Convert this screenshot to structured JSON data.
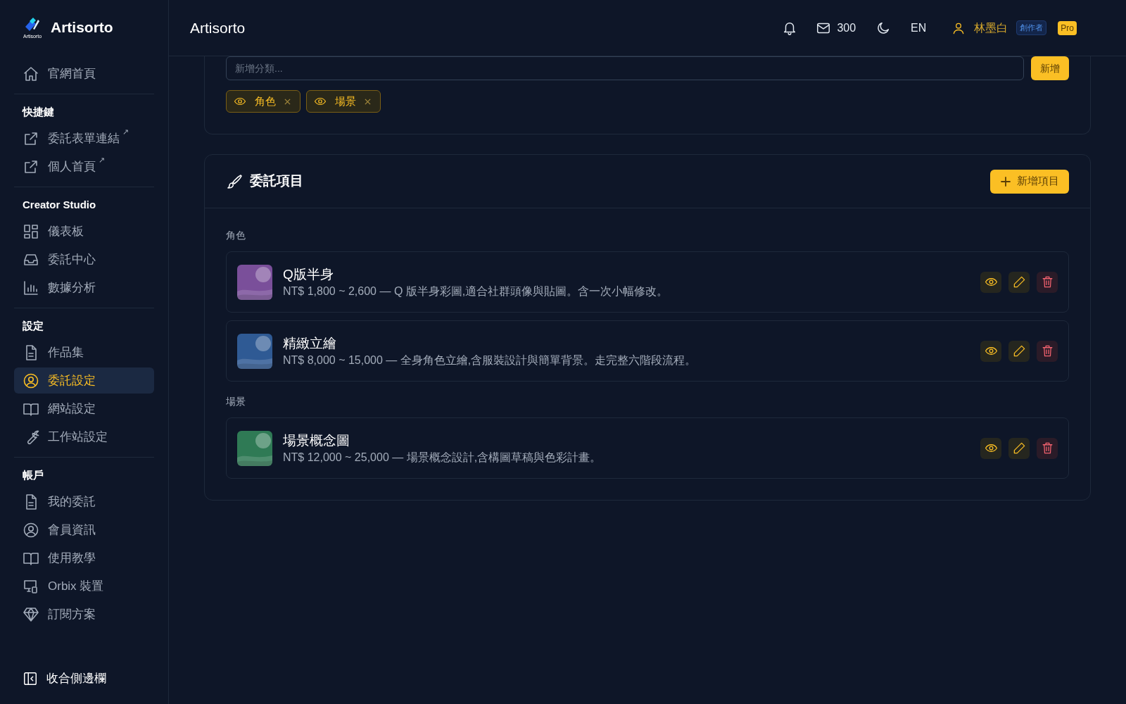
{
  "sidebar": {
    "brand": "Artisorto",
    "logo_caption": "Artisorto",
    "top_items": [
      {
        "label": "官網首頁",
        "selected": false
      }
    ],
    "sections": [
      {
        "title": "快捷鍵",
        "items": [
          {
            "label": "委託表單連結",
            "suffix": "↗",
            "selected": false
          },
          {
            "label": "個人首頁",
            "suffix": "↗",
            "selected": false
          }
        ]
      },
      {
        "title": "Creator Studio",
        "items": [
          {
            "label": "儀表板",
            "selected": false
          },
          {
            "label": "委託中心",
            "selected": false
          },
          {
            "label": "數據分析",
            "selected": false
          }
        ]
      },
      {
        "title": "設定",
        "items": [
          {
            "label": "作品集",
            "selected": false
          },
          {
            "label": "委託設定",
            "selected": true
          },
          {
            "label": "網站設定",
            "selected": false
          },
          {
            "label": "工作站設定",
            "selected": false
          }
        ]
      },
      {
        "title": "帳戶",
        "items": [
          {
            "label": "我的委託",
            "selected": false
          },
          {
            "label": "會員資訊",
            "selected": false
          },
          {
            "label": "使用教學",
            "selected": false
          },
          {
            "label": "Orbix 裝置",
            "selected": false
          },
          {
            "label": "訂閱方案",
            "selected": false
          }
        ]
      }
    ],
    "collapse": "收合側邊欄"
  },
  "header": {
    "title": "Artisorto",
    "mail_count": "300",
    "language": "EN",
    "user": "林墨白",
    "role_badge": "創作者",
    "plan_badge": "Pro"
  },
  "categories": {
    "placeholder": "新增分類...",
    "add_button": "新增",
    "tags": [
      {
        "label": "角色",
        "visible": true
      },
      {
        "label": "場景",
        "visible": true
      }
    ]
  },
  "items_card": {
    "title": "委託項目",
    "add_button": "新增項目",
    "groups": [
      {
        "label": "角色",
        "items": [
          {
            "title": "Q版半身",
            "description": "NT$ 1,800 ~ 2,600 — Q 版半身彩圖,適合社群頭像與貼圖。含一次小幅修改。",
            "color": "#7a4f9a"
          },
          {
            "title": "精緻立繪",
            "description": "NT$ 8,000 ~ 15,000 — 全身角色立繪,含服裝設計與簡單背景。走完整六階段流程。",
            "color": "#2f5a94"
          }
        ]
      },
      {
        "label": "場景",
        "items": [
          {
            "title": "場景概念圖",
            "description": "NT$ 12,000 ~ 25,000 — 場景概念設計,含構圖草稿與色彩計畫。",
            "color": "#2f7a55"
          }
        ]
      }
    ]
  }
}
